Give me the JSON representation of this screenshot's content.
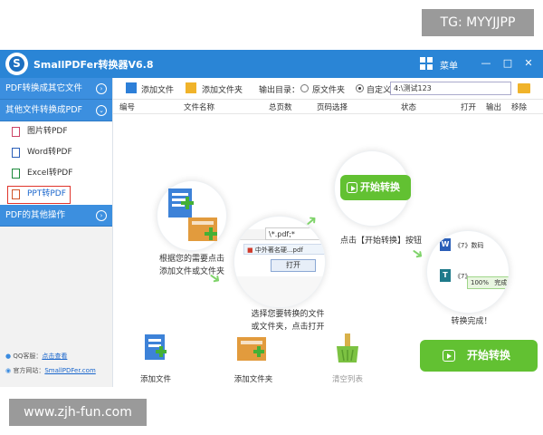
{
  "watermarks": {
    "top": "TG: MYYJJPP",
    "bottom": "www.zjh-fun.com"
  },
  "window": {
    "title": "SmallPDFer转换器V6.8",
    "menu_label": "菜单",
    "controls": {
      "minimize": "—",
      "maximize": "□",
      "close": "✕"
    }
  },
  "sidebar": {
    "section1": "PDF转换成其它文件",
    "section2": "其他文件转换成PDF",
    "items": [
      "图片转PDF",
      "Word转PDF",
      "Excel转PDF",
      "PPT转PDF"
    ],
    "section3": "PDF的其他操作",
    "qq_label": "QQ客服：",
    "qq_link": "点击查看",
    "site_label": "官方网站：",
    "site_link": "SmallPDFer.com"
  },
  "toolbar": {
    "add_file": "添加文件",
    "add_folder": "添加文件夹",
    "output_label": "输出目录：",
    "radio_source": "原文件夹",
    "radio_custom": "自定义",
    "path_value": "4:\\测试123"
  },
  "table_headers": [
    "编号",
    "文件名称",
    "总页数",
    "页码选择",
    "状态",
    "打开",
    "输出",
    "移除"
  ],
  "guide": {
    "step1": [
      "根据您的需要点击",
      "添加文件或文件夹"
    ],
    "step2": [
      "选择您要转换的文件",
      "或文件夹，点击打开"
    ],
    "step2_file": "中外著名硬...pdf",
    "step2_filename_bar": "\\*.pdf;*",
    "step2_open_button": "打开",
    "step3": "点击【开始转换】按钮",
    "step3_button": "开始转换",
    "step4": "转换完成！",
    "step4_word": "《7》数码",
    "step4_ppt": "《7》",
    "step4_progress": "100%",
    "step4_done": "完成"
  },
  "bottom_tools": {
    "add_file": "添加文件",
    "add_folder": "添加文件夹",
    "clear": "清空列表"
  },
  "start_button": "开始转换",
  "colors": {
    "titlebar": "#2a85d6",
    "sidebar_section": "#3c8fdf",
    "green": "#62c132",
    "active_border": "#e0342b"
  }
}
